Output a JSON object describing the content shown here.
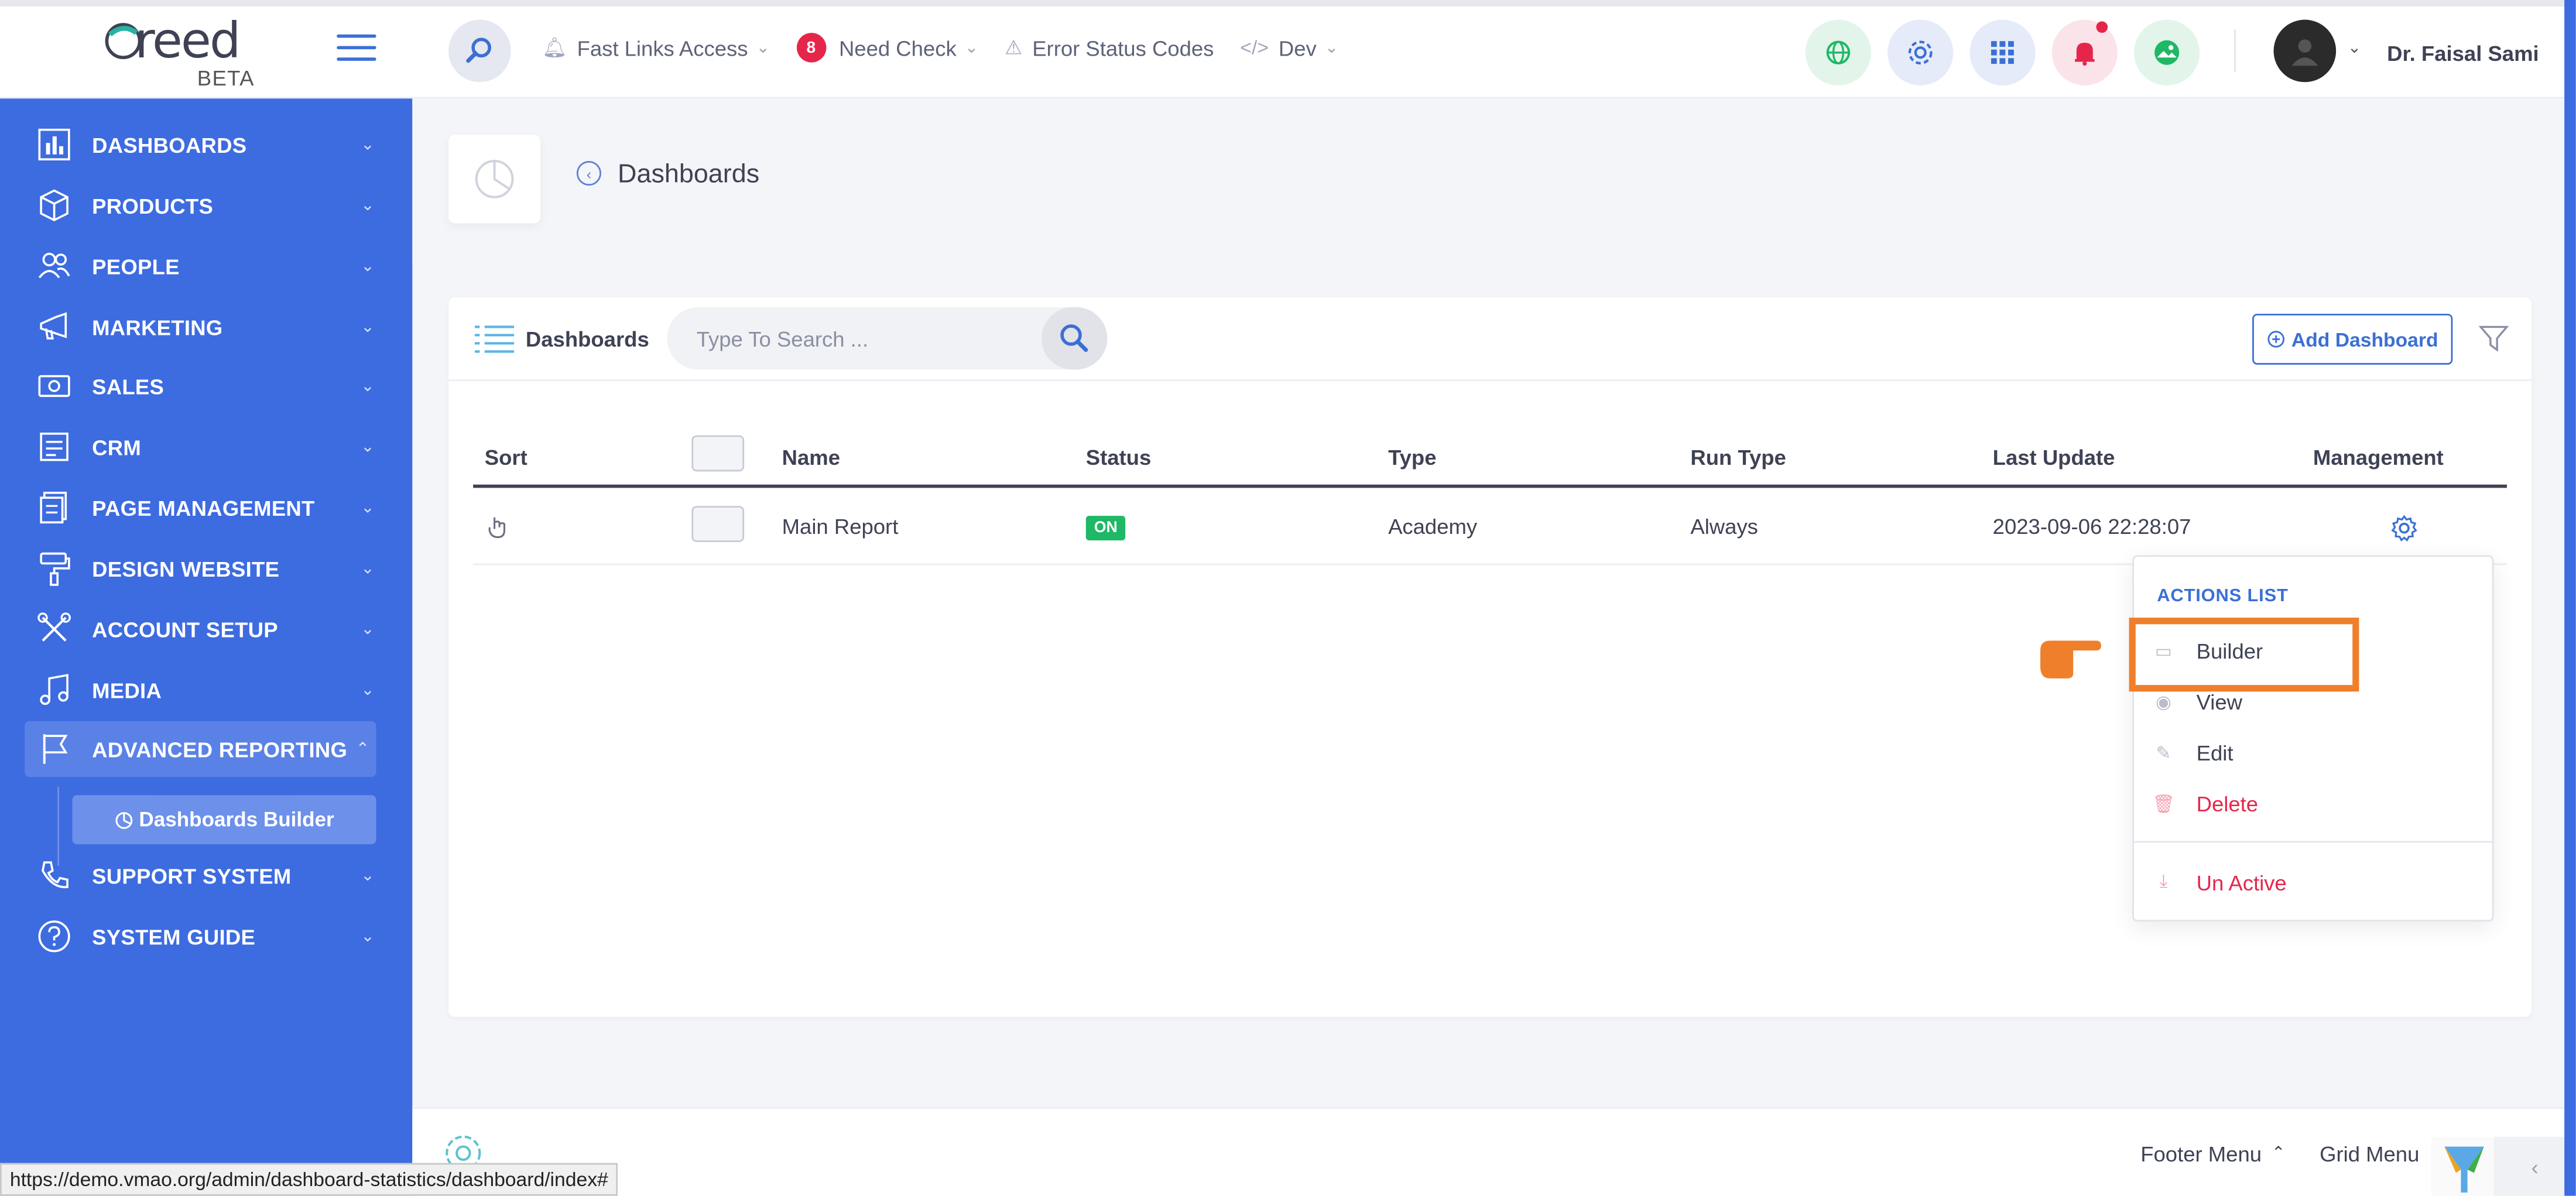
{
  "header": {
    "logo_text": "reed",
    "logo_sub": "BETA",
    "nav": [
      {
        "label": "Fast Links Access",
        "icon": "bell-outline-icon"
      },
      {
        "label": "Need Check",
        "count": "8"
      },
      {
        "label": "Error Status Codes",
        "icon": "warning-icon"
      },
      {
        "label": "Dev",
        "icon": "code-icon"
      }
    ],
    "user_name": "Dr. Faisal Sami"
  },
  "sidebar": {
    "items": [
      {
        "label": "DASHBOARDS",
        "icon": "bar-chart-icon"
      },
      {
        "label": "PRODUCTS",
        "icon": "box-icon"
      },
      {
        "label": "PEOPLE",
        "icon": "people-icon"
      },
      {
        "label": "MARKETING",
        "icon": "megaphone-icon"
      },
      {
        "label": "SALES",
        "icon": "cash-icon"
      },
      {
        "label": "CRM",
        "icon": "crm-icon"
      },
      {
        "label": "PAGE MANAGEMENT",
        "icon": "pages-icon"
      },
      {
        "label": "DESIGN WEBSITE",
        "icon": "paint-roller-icon"
      },
      {
        "label": "ACCOUNT SETUP",
        "icon": "tools-icon"
      },
      {
        "label": "MEDIA",
        "icon": "music-icon"
      },
      {
        "label": "ADVANCED REPORTING",
        "icon": "flag-icon"
      },
      {
        "label": "SUPPORT SYSTEM",
        "icon": "phone-icon"
      },
      {
        "label": "SYSTEM GUIDE",
        "icon": "help-icon"
      }
    ],
    "sub_item": "Dashboards Builder"
  },
  "page": {
    "title": "Dashboards"
  },
  "card": {
    "title": "Dashboards",
    "search_placeholder": "Type To Search ...",
    "add_button": "Add Dashboard"
  },
  "table": {
    "columns": [
      "Sort",
      "Name",
      "Status",
      "Type",
      "Run Type",
      "Last Update",
      "Management"
    ],
    "rows": [
      {
        "name": "Main Report",
        "status": "ON",
        "type": "Academy",
        "run_type": "Always",
        "last_update": "2023-09-06 22:28:07"
      }
    ]
  },
  "actions": {
    "title": "ACTIONS LIST",
    "items": [
      "Builder",
      "View",
      "Edit",
      "Delete",
      "Un Active"
    ]
  },
  "footer": {
    "footer_menu": "Footer Menu",
    "grid_menu": "Grid Menu"
  },
  "status_url": "https://demo.vmao.org/admin/dashboard-statistics/dashboard/index#",
  "colors": {
    "sidebar": "#3d6be0",
    "accent": "#3b6fd4",
    "danger": "#e5264b",
    "success": "#1fb866",
    "highlight": "#f07f2b"
  }
}
